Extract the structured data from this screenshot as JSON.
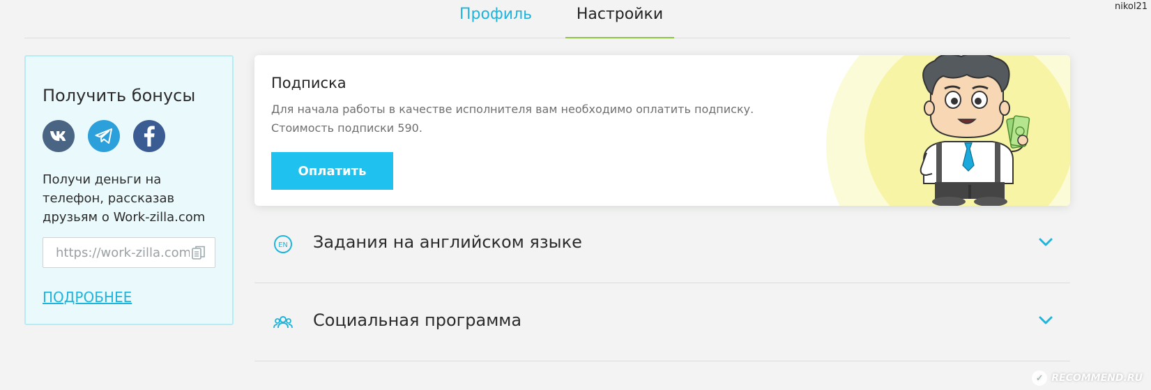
{
  "header": {
    "tabs": [
      {
        "label": "Профиль",
        "active": false
      },
      {
        "label": "Настройки",
        "active": true
      }
    ],
    "username": "nikol21"
  },
  "bonus": {
    "title": "Получить бонусы",
    "socials": [
      {
        "icon": "vk-icon",
        "label": "VK",
        "color": "#4a6484"
      },
      {
        "icon": "telegram-icon",
        "label": "Telegram",
        "color": "#2ba0db"
      },
      {
        "icon": "facebook-icon",
        "label": "Facebook",
        "color": "#3b5c93"
      }
    ],
    "text": "Получи деньги на телефон, рассказав друзьям о Work-zilla.com",
    "ref_link_value": "https://work-zilla.com",
    "copy_icon": "copy-icon",
    "more_label": "ПОДРОБНЕЕ"
  },
  "subscription": {
    "title": "Подписка",
    "desc_line1": "Для начала работы в качестве исполнителя вам необходимо оплатить подписку.",
    "desc_line2": "Стоимость подписки 590.",
    "pay_label": "Оплатить",
    "pay_color": "#1fc1ef"
  },
  "sections": [
    {
      "icon": "en-language-icon",
      "label": "Задания на английском языке",
      "expanded": false
    },
    {
      "icon": "people-group-icon",
      "label": "Социальная программа",
      "expanded": false
    }
  ],
  "colors": {
    "accent": "#1eb4dc",
    "active_tab_underline": "#8cc63f",
    "background": "#f2f3f2"
  },
  "watermark": {
    "text": "RECOMMEND.RU"
  }
}
